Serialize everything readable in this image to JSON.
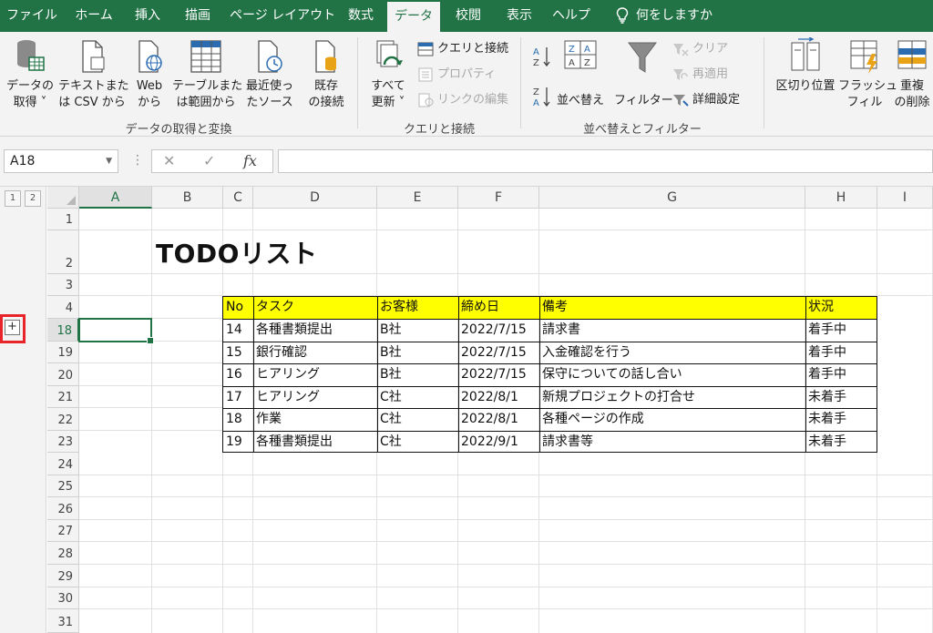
{
  "tabs": [
    {
      "label": "ファイル",
      "active": false
    },
    {
      "label": "ホーム",
      "active": false
    },
    {
      "label": "挿入",
      "active": false
    },
    {
      "label": "描画",
      "active": false
    },
    {
      "label": "ページ レイアウト",
      "active": false
    },
    {
      "label": "数式",
      "active": false
    },
    {
      "label": "データ",
      "active": true
    },
    {
      "label": "校閲",
      "active": false
    },
    {
      "label": "表示",
      "active": false
    },
    {
      "label": "ヘルプ",
      "active": false
    }
  ],
  "tell_me": "何をしますか",
  "ribbon": {
    "get_data": {
      "line1": "データの",
      "line2": "取得 ˅"
    },
    "from_text": {
      "line1": "テキストまた",
      "line2": "は CSV から"
    },
    "from_web": {
      "line1": "Web",
      "line2": "から"
    },
    "from_table": {
      "line1": "テーブルまた",
      "line2": "は範囲から"
    },
    "recent": {
      "line1": "最近使っ",
      "line2": "たソース"
    },
    "existing": {
      "line1": "既存",
      "line2": "の接続"
    },
    "group1_label": "データの取得と変換",
    "refresh_all": {
      "line1": "すべて",
      "line2": "更新 ˅"
    },
    "queries_connections": "クエリと接続",
    "properties": "プロパティ",
    "edit_links": "リンクの編集",
    "group2_label": "クエリと接続",
    "sort": "並べ替え",
    "filter": "フィルター",
    "clear": "クリア",
    "reapply": "再適用",
    "advanced": "詳細設定",
    "group3_label": "並べ替えとフィルター",
    "text_to_columns": "区切り位置",
    "flash_fill": {
      "line1": "フラッシュ",
      "line2": "フィル"
    },
    "remove_duplicates": {
      "line1": "重複",
      "line2": "の削除"
    }
  },
  "formula_bar": {
    "name_box": "A18",
    "fx": "fx",
    "value": ""
  },
  "outline_levels": [
    "1",
    "2"
  ],
  "outline_expand": "+",
  "columns": [
    "A",
    "B",
    "C",
    "D",
    "E",
    "F",
    "G",
    "H",
    "I"
  ],
  "rows": [
    "1",
    "2",
    "3",
    "4",
    "18",
    "19",
    "20",
    "21",
    "22",
    "23",
    "24",
    "25",
    "26",
    "27",
    "28",
    "29",
    "30",
    "31"
  ],
  "selected_cell": {
    "column": "A",
    "row": "18"
  },
  "sheet_title": "TODOリスト",
  "table": {
    "headers": [
      "No",
      "タスク",
      "お客様",
      "締め日",
      "備考",
      "状況"
    ],
    "rows": [
      [
        "14",
        "各種書類提出",
        "B社",
        "2022/7/15",
        "請求書",
        "着手中"
      ],
      [
        "15",
        "銀行確認",
        "B社",
        "2022/7/15",
        "入金確認を行う",
        "着手中"
      ],
      [
        "16",
        "ヒアリング",
        "B社",
        "2022/7/15",
        "保守についての話し合い",
        "着手中"
      ],
      [
        "17",
        "ヒアリング",
        "C社",
        "2022/8/1",
        "新規プロジェクトの打合せ",
        "未着手"
      ],
      [
        "18",
        "作業",
        "C社",
        "2022/8/1",
        "各種ページの作成",
        "未着手"
      ],
      [
        "19",
        "各種書類提出",
        "C社",
        "2022/9/1",
        "請求書等",
        "未着手"
      ]
    ]
  },
  "colors": {
    "excel_green": "#217346",
    "header_fill": "#ffff00",
    "highlight_box": "#e8232a"
  }
}
